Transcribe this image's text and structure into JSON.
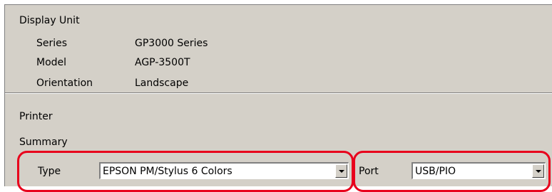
{
  "display_unit": {
    "heading": "Display Unit",
    "series_label": "Series",
    "series_value": "GP3000 Series",
    "model_label": "Model",
    "model_value": "AGP-3500T",
    "orientation_label": "Orientation",
    "orientation_value": "Landscape"
  },
  "printer": {
    "heading": "Printer",
    "summary_label": "Summary",
    "type_label": "Type",
    "type_value": "EPSON PM/Stylus 6 Colors",
    "port_label": "Port",
    "port_value": "USB/PIO"
  },
  "colors": {
    "panel_bg": "#d4d0c8",
    "highlight": "#e8001c"
  }
}
